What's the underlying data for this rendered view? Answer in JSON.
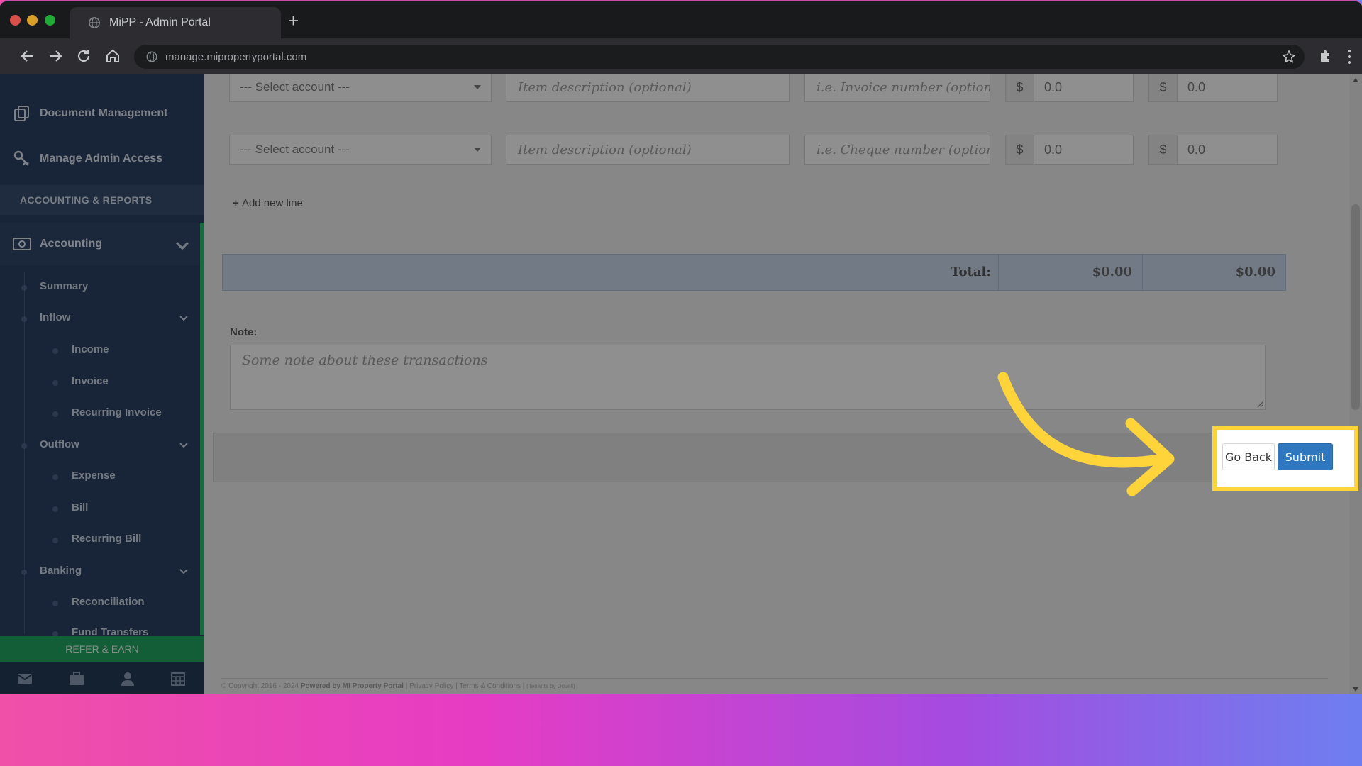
{
  "browser": {
    "tab_title": "MiPP - Admin Portal",
    "url": "manage.mipropertyportal.com"
  },
  "sidebar": {
    "top_items": [
      {
        "label": "Document Management",
        "icon": "documents-icon"
      },
      {
        "label": "Manage Admin Access",
        "icon": "key-icon"
      }
    ],
    "section_header": "ACCOUNTING & REPORTS",
    "accounting": {
      "label": "Accounting",
      "icon": "money-icon"
    },
    "items": {
      "summary": "Summary",
      "inflow": "Inflow",
      "income": "Income",
      "invoice": "Invoice",
      "recurring_invoice": "Recurring Invoice",
      "outflow": "Outflow",
      "expense": "Expense",
      "bill": "Bill",
      "recurring_bill": "Recurring Bill",
      "banking": "Banking",
      "reconciliation": "Reconciliation",
      "fund_transfers": "Fund Transfers"
    },
    "refer_label": "REFER & EARN",
    "bottom_icons": [
      "mail-icon",
      "briefcase-icon",
      "user-icon",
      "calendar-icon"
    ]
  },
  "form": {
    "rows": [
      {
        "account_placeholder": "--- Select account ---",
        "description_placeholder": "Item description (optional)",
        "reference_placeholder": "i.e. Invoice number (optional)",
        "currency_1": "$",
        "amount_1": "0.0",
        "currency_2": "$",
        "amount_2": "0.0"
      },
      {
        "account_placeholder": "--- Select account ---",
        "description_placeholder": "Item description (optional)",
        "reference_placeholder": "i.e. Cheque number (optional)",
        "currency_1": "$",
        "amount_1": "0.0",
        "currency_2": "$",
        "amount_2": "0.0"
      }
    ],
    "add_line": "Add new line",
    "total_label": "Total:",
    "total_1": "$0.00",
    "total_2": "$0.00",
    "note_label": "Note:",
    "note_placeholder": "Some note about these transactions"
  },
  "actions": {
    "go_back": "Go Back",
    "submit": "Submit"
  },
  "footer": {
    "copyright": "© Copyright 2016 - 2024",
    "powered": "Powered by MI Property Portal",
    "links": "| Privacy Policy | Terms & Conditions |",
    "tiny": "(Tenants by Dovell)"
  },
  "colors": {
    "sidebar_bg": "#2a3f5f",
    "accent_green": "#2bb673",
    "submit_blue": "#2f78bf",
    "highlight_yellow": "#ffd43b"
  }
}
